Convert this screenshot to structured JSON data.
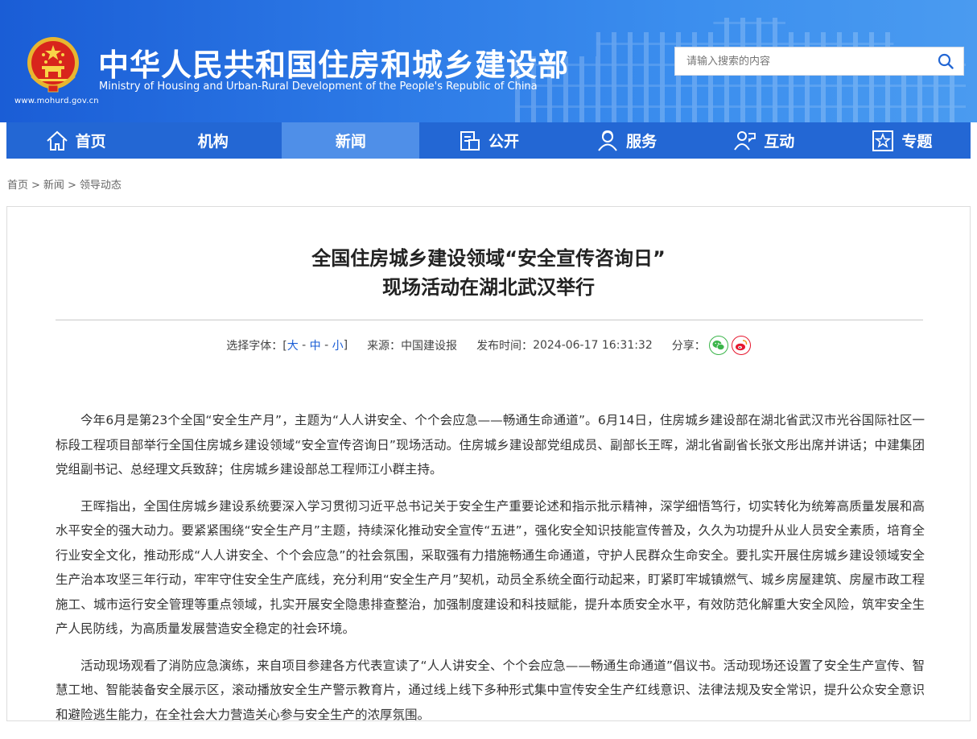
{
  "header": {
    "title": "中华人民共和国住房和城乡建设部",
    "subtitle": "Ministry of Housing and Urban-Rural Development of the People's Republic of China",
    "url": "www.mohurd.gov.cn",
    "emblem_icon": "national-emblem-icon"
  },
  "search": {
    "placeholder": "请输入搜索的内容",
    "icon": "search-icon"
  },
  "nav": {
    "items": [
      {
        "label": "首页",
        "icon": "home-icon"
      },
      {
        "label": "机构",
        "icon": ""
      },
      {
        "label": "新闻",
        "icon": "",
        "active": true
      },
      {
        "label": "公开",
        "icon": "document-icon"
      },
      {
        "label": "服务",
        "icon": "user-service-icon"
      },
      {
        "label": "互动",
        "icon": "interaction-icon"
      },
      {
        "label": "专题",
        "icon": "star-icon"
      }
    ]
  },
  "breadcrumb": {
    "items": [
      "首页",
      "新闻",
      "领导动态"
    ],
    "separator": ">"
  },
  "article": {
    "title_line1": "全国住房城乡建设领域“安全宣传咨询日”",
    "title_line2": "现场活动在湖北武汉举行",
    "font_size_label": "选择字体：[",
    "font_size_options": [
      "大",
      "中",
      "小"
    ],
    "font_size_close": "]",
    "source_label": "来源：",
    "source": "中国建设报",
    "time_label": "发布时间：",
    "time": "2024-06-17 16:31:32",
    "share_label": "分享：",
    "share_icons": [
      "wechat-icon",
      "weibo-icon"
    ],
    "paragraphs": [
      "今年6月是第23个全国“安全生产月”，主题为“人人讲安全、个个会应急——畅通生命通道”。6月14日，住房城乡建设部在湖北省武汉市光谷国际社区一标段工程项目部举行全国住房城乡建设领域“安全宣传咨询日”现场活动。住房城乡建设部党组成员、副部长王晖，湖北省副省长张文彤出席并讲话；中建集团党组副书记、总经理文兵致辞；住房城乡建设部总工程师江小群主持。",
      "王晖指出，全国住房城乡建设系统要深入学习贯彻习近平总书记关于安全生产重要论述和指示批示精神，深学细悟笃行，切实转化为统筹高质量发展和高水平安全的强大动力。要紧紧围绕“安全生产月”主题，持续深化推动安全宣传“五进”，强化安全知识技能宣传普及，久久为功提升从业人员安全素质，培育全行业安全文化，推动形成“人人讲安全、个个会应急”的社会氛围，采取强有力措施畅通生命通道，守护人民群众生命安全。要扎实开展住房城乡建设领域安全生产治本攻坚三年行动，牢牢守住安全生产底线，充分利用“安全生产月”契机，动员全系统全面行动起来，盯紧盯牢城镇燃气、城乡房屋建筑、房屋市政工程施工、城市运行安全管理等重点领域，扎实开展安全隐患排查整治，加强制度建设和科技赋能，提升本质安全水平，有效防范化解重大安全风险，筑牢安全生产人民防线，为高质量发展营造安全稳定的社会环境。",
      "活动现场观看了消防应急演练，来自项目参建各方代表宣读了“人人讲安全、个个会应急——畅通生命通道”倡议书。活动现场还设置了安全生产宣传、智慧工地、智能装备安全展示区，滚动播放安全生产警示教育片，通过线上线下多种形式集中宣传安全生产红线意识、法律法规及安全常识，提升公众安全意识和避险逃生能力，在全社会大力营造关心参与安全生产的浓厚氛围。"
    ]
  },
  "colors": {
    "header_blue": "#1a5dd6",
    "nav_blue": "#2367d4",
    "nav_active": "#4f8fe8",
    "link_blue": "#1a5dd6"
  }
}
